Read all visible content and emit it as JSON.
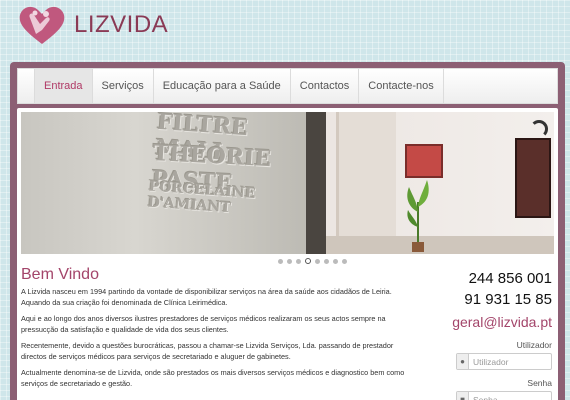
{
  "brand": {
    "name": "LIZVIDA",
    "color": "#8a3a55"
  },
  "nav": {
    "items": [
      {
        "label": "Entrada",
        "active": true
      },
      {
        "label": "Serviços",
        "active": false
      },
      {
        "label": "Educação para a Saúde",
        "active": false
      },
      {
        "label": "Contactos",
        "active": false
      },
      {
        "label": "Contacte-nos",
        "active": false
      }
    ]
  },
  "slider": {
    "jar_text": [
      "FILTRE MALL",
      "THEORIE PASTE",
      "PORCELAINE D'AMIANT"
    ],
    "dot_count": 8,
    "active_dot": 4
  },
  "article": {
    "title": "Bem Vindo",
    "paragraphs": [
      "A Lizvida nasceu em 1994 partindo da vontade de disponibilizar serviços na área da saúde aos cidadãos de Leiria. Aquando da sua criação foi denominada de Clínica Leirimédica.",
      "Aqui e ao longo dos anos diversos  ilustres prestadores de serviços médicos realizaram os seus actos sempre na pressucção da satisfação e qualidade de vida dos seus clientes.",
      "Recentemente, devido a questões burocráticas, passou a chamar-se Lizvida Serviços, Lda. passando de prestador directos de serviços médicos para serviços de secretariado e aluguer de gabinetes.",
      "Actualmente denomina-se de Lizvida, onde são prestados os mais diversos serviços médicos e diagnostico bem como serviços de secretariado e gestão."
    ]
  },
  "contact": {
    "phone1": "244 856 001",
    "phone2": "91 931 15 85",
    "email": "geral@lizvida.pt"
  },
  "login": {
    "user_label": "Utilizador",
    "user_placeholder": "Utilizador",
    "pass_label": "Senha",
    "pass_placeholder": "Senha"
  }
}
